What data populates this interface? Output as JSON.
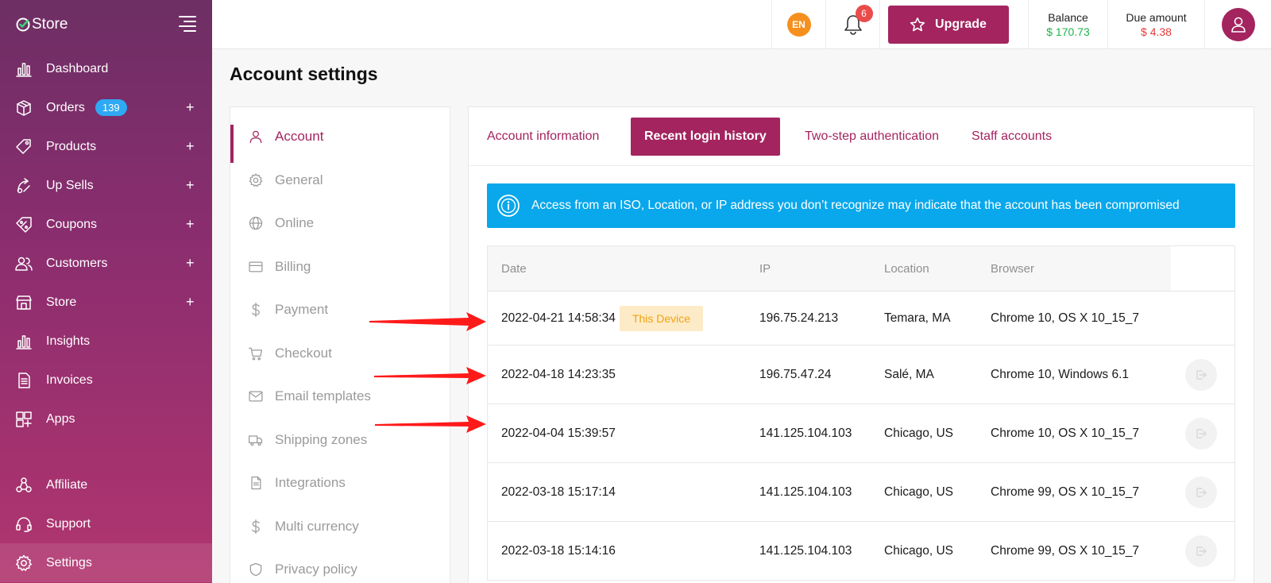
{
  "brand": {
    "name": "Store"
  },
  "sidebar": {
    "items": [
      {
        "label": "Dashboard",
        "icon": "chart-icon",
        "expandable": false
      },
      {
        "label": "Orders",
        "icon": "box-icon",
        "badge": "139",
        "expandable": true
      },
      {
        "label": "Products",
        "icon": "tag-icon",
        "expandable": true
      },
      {
        "label": "Up Sells",
        "icon": "upsell-icon",
        "expandable": true
      },
      {
        "label": "Coupons",
        "icon": "coupon-icon",
        "expandable": true
      },
      {
        "label": "Customers",
        "icon": "users-icon",
        "expandable": true
      },
      {
        "label": "Store",
        "icon": "storefront-icon",
        "expandable": true
      },
      {
        "label": "Insights",
        "icon": "chart-icon",
        "expandable": false
      },
      {
        "label": "Invoices",
        "icon": "document-icon",
        "expandable": false
      },
      {
        "label": "Apps",
        "icon": "apps-icon",
        "expandable": false
      }
    ],
    "lower_items": [
      {
        "label": "Affiliate",
        "icon": "affiliate-icon"
      },
      {
        "label": "Support",
        "icon": "headset-icon"
      },
      {
        "label": "Settings",
        "icon": "gear-icon",
        "active": true
      }
    ],
    "expand_symbol": "+"
  },
  "topbar": {
    "language": "EN",
    "notifications_count": "6",
    "upgrade_label": "Upgrade",
    "balance_label": "Balance",
    "balance_value": "$ 170.73",
    "due_label": "Due amount",
    "due_value": "$ 4.38"
  },
  "page": {
    "title": "Account settings"
  },
  "settings_menu": [
    {
      "label": "Account",
      "icon": "user-icon",
      "active": true
    },
    {
      "label": "General",
      "icon": "gear-icon"
    },
    {
      "label": "Online",
      "icon": "globe-icon"
    },
    {
      "label": "Billing",
      "icon": "card-icon"
    },
    {
      "label": "Payment",
      "icon": "dollar-icon"
    },
    {
      "label": "Checkout",
      "icon": "cart-icon"
    },
    {
      "label": "Email templates",
      "icon": "mail-icon"
    },
    {
      "label": "Shipping zones",
      "icon": "truck-icon"
    },
    {
      "label": "Integrations",
      "icon": "file-icon"
    },
    {
      "label": "Multi currency",
      "icon": "dollar-icon"
    },
    {
      "label": "Privacy policy",
      "icon": "shield-icon"
    }
  ],
  "tabs": [
    {
      "label": "Account information",
      "active": false
    },
    {
      "label": "Recent login history",
      "active": true
    },
    {
      "label": "Two-step authentication",
      "active": false
    },
    {
      "label": "Staff accounts",
      "active": false
    }
  ],
  "alert": {
    "text": "Access from an ISO, Location, or IP address you don’t recognize may indicate that the account has been compromised"
  },
  "table": {
    "headers": [
      "Date",
      "IP",
      "Location",
      "Browser"
    ],
    "rows": [
      {
        "date": "2022-04-21 14:58:34",
        "tag": "This Device",
        "ip": "196.75.24.213",
        "location": "Temara, MA",
        "browser": "Chrome 10, OS X 10_15_7",
        "logout": false
      },
      {
        "date": "2022-04-18 14:23:35",
        "ip": "196.75.47.24",
        "location": "Salé, MA",
        "browser": "Chrome 10, Windows 6.1",
        "logout": true
      },
      {
        "date": "2022-04-04 15:39:57",
        "ip": "141.125.104.103",
        "location": "Chicago, US",
        "browser": "Chrome 10, OS X 10_15_7",
        "logout": true
      },
      {
        "date": "2022-03-18 15:17:14",
        "ip": "141.125.104.103",
        "location": "Chicago, US",
        "browser": "Chrome 99, OS X 10_15_7",
        "logout": true
      },
      {
        "date": "2022-03-18 15:14:16",
        "ip": "141.125.104.103",
        "location": "Chicago, US",
        "browser": "Chrome 99, OS X 10_15_7",
        "logout": true
      }
    ]
  },
  "colors": {
    "brand": "#a3245f",
    "positive": "#20b34a",
    "negative": "#e9383a",
    "alert": "#09a7eb",
    "annotation": "#ff1a1a"
  }
}
